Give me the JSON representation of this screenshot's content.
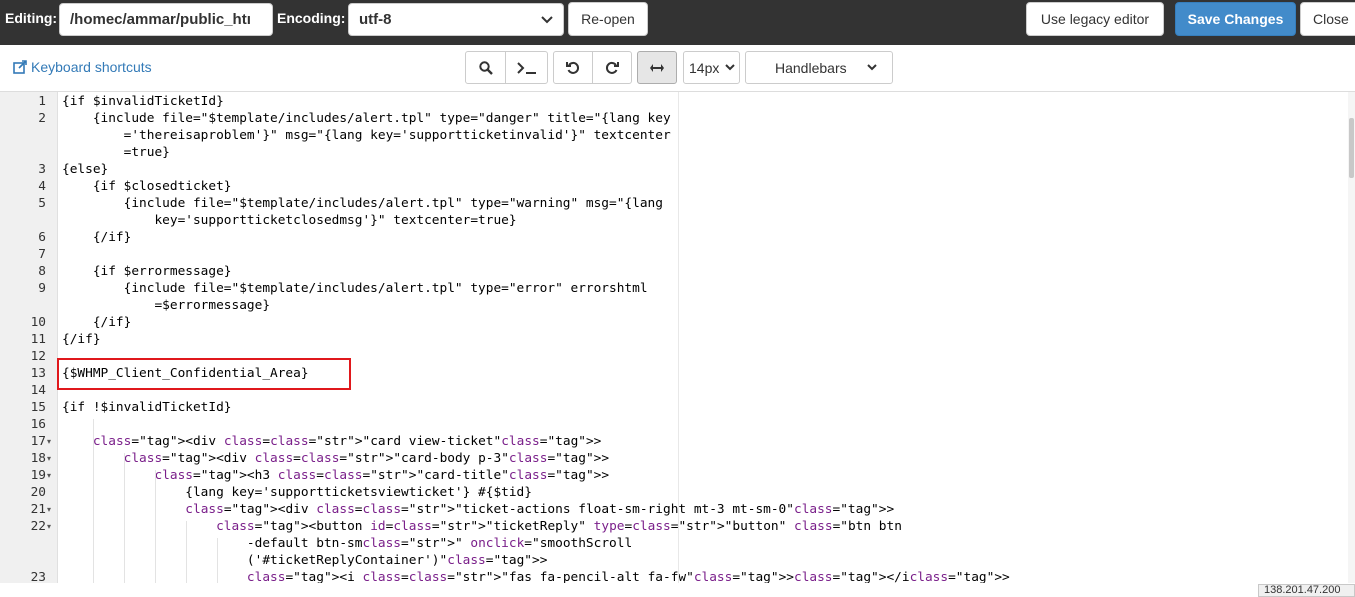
{
  "header": {
    "editing_label": "Editing:",
    "path_value": "/homec/ammar/public_htı",
    "encoding_label": "Encoding:",
    "encoding_value": "utf-8",
    "reopen_label": "Re-open",
    "legacy_label": "Use legacy editor",
    "save_label": "Save Changes",
    "close_label": "Close"
  },
  "toolbar": {
    "shortcuts_label": "Keyboard shortcuts",
    "search_icon": "search-icon",
    "terminal_icon": "terminal-icon",
    "undo_icon": "undo-icon",
    "redo_icon": "redo-icon",
    "wrap_icon": "arrows-horizontal-icon",
    "font_size_value": "14px",
    "mode_value": "Handlebars"
  },
  "editor": {
    "lines": [
      {
        "num": "1",
        "text": "{if $invalidTicketId}"
      },
      {
        "num": "2",
        "text": "    {include file=\"$template/includes/alert.tpl\" type=\"danger\" title=\"{lang key"
      },
      {
        "num": "",
        "text": "        ='thereisaproblem'}\" msg=\"{lang key='supportticketinvalid'}\" textcenter"
      },
      {
        "num": "",
        "text": "        =true}"
      },
      {
        "num": "3",
        "text": "{else}"
      },
      {
        "num": "4",
        "text": "    {if $closedticket}"
      },
      {
        "num": "5",
        "text": "        {include file=\"$template/includes/alert.tpl\" type=\"warning\" msg=\"{lang"
      },
      {
        "num": "",
        "text": "            key='supportticketclosedmsg'}\" textcenter=true}"
      },
      {
        "num": "6",
        "text": "    {/if}"
      },
      {
        "num": "7",
        "text": ""
      },
      {
        "num": "8",
        "text": "    {if $errormessage}"
      },
      {
        "num": "9",
        "text": "        {include file=\"$template/includes/alert.tpl\" type=\"error\" errorshtml"
      },
      {
        "num": "",
        "text": "            =$errormessage}"
      },
      {
        "num": "10",
        "text": "    {/if}"
      },
      {
        "num": "11",
        "text": "{/if}"
      },
      {
        "num": "12",
        "text": ""
      },
      {
        "num": "13",
        "text": "{$WHMP_Client_Confidential_Area}"
      },
      {
        "num": "14",
        "text": ""
      },
      {
        "num": "15",
        "text": "{if !$invalidTicketId}"
      },
      {
        "num": "16",
        "text": ""
      },
      {
        "num": "17",
        "text": "    <div class=\"card view-ticket\">",
        "fold": true
      },
      {
        "num": "18",
        "text": "        <div class=\"card-body p-3\">",
        "fold": true
      },
      {
        "num": "19",
        "text": "            <h3 class=\"card-title\">",
        "fold": true
      },
      {
        "num": "20",
        "text": "                {lang key='supportticketsviewticket'} #{$tid}"
      },
      {
        "num": "21",
        "text": "                <div class=\"ticket-actions float-sm-right mt-3 mt-sm-0\">",
        "fold": true
      },
      {
        "num": "22",
        "text": "                    <button id=\"ticketReply\" type=\"button\" class=\"btn btn",
        "fold": true
      },
      {
        "num": "",
        "text": "                        -default btn-sm\" onclick=\"smoothScroll"
      },
      {
        "num": "",
        "text": "                        ('#ticketReplyContainer')\">"
      },
      {
        "num": "23",
        "text": "                        <i class=\"fas fa-pencil-alt fa-fw\"></i>"
      }
    ]
  },
  "status": {
    "ip": "138.201.47.200"
  }
}
